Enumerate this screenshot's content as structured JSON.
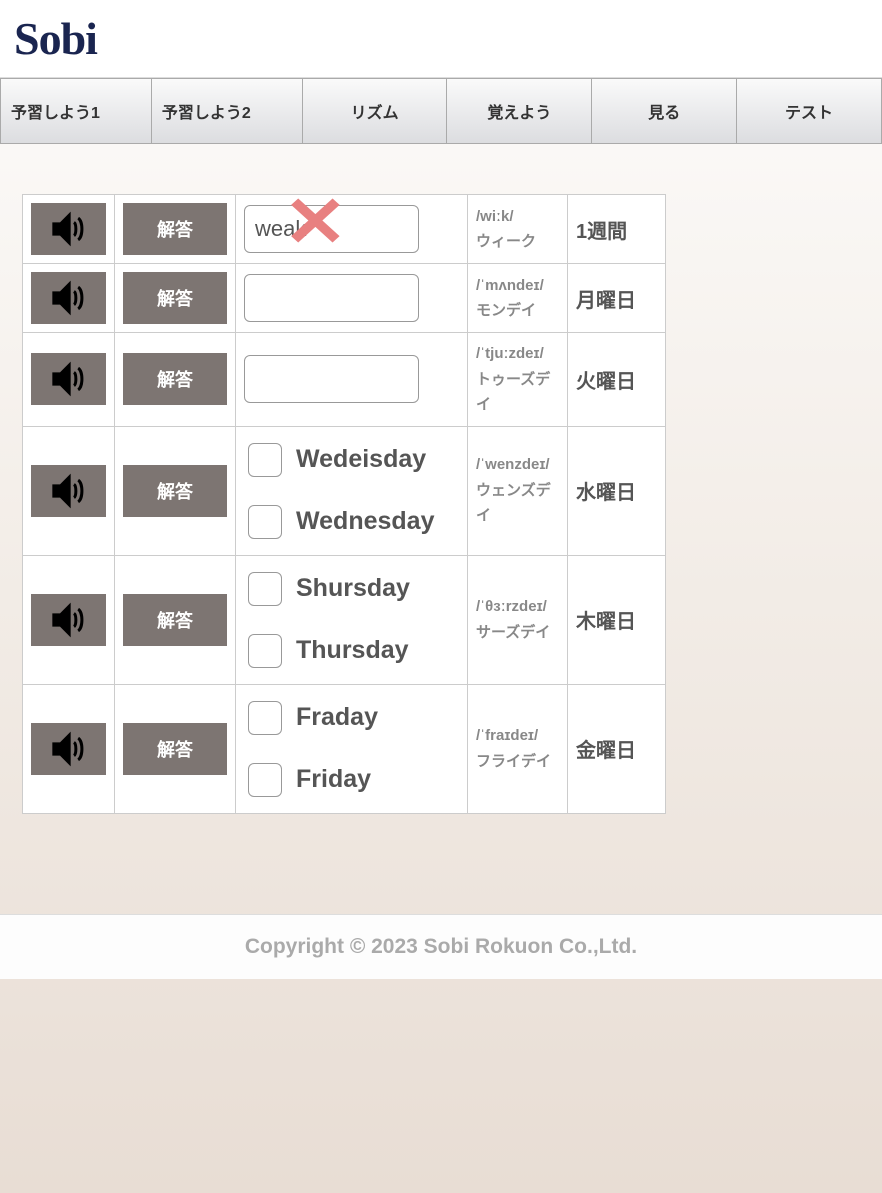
{
  "logo": "Sobi",
  "tabs": [
    "予習しよう1",
    "予習しよう2",
    "リズム",
    "覚えよう",
    "見る",
    "テスト"
  ],
  "answer_label": "解答",
  "rows": [
    {
      "type": "input",
      "input_value": "weak",
      "wrong": true,
      "phonetic": "/wiːk/\nウィーク",
      "japanese": "1週間"
    },
    {
      "type": "input",
      "input_value": "",
      "wrong": false,
      "phonetic": "/ˈmʌndeɪ/\nモンデイ",
      "japanese": "月曜日"
    },
    {
      "type": "input",
      "input_value": "",
      "wrong": false,
      "phonetic": "/ˈtjuːzdeɪ/\nトゥーズデイ",
      "japanese": "火曜日"
    },
    {
      "type": "choice",
      "options": [
        "Wedeisday",
        "Wednesday"
      ],
      "phonetic": "/ˈwenzdeɪ/\nウェンズデイ",
      "japanese": "水曜日"
    },
    {
      "type": "choice",
      "options": [
        "Shursday",
        "Thursday"
      ],
      "phonetic": "/ˈθɜːrzdeɪ/\nサーズデイ",
      "japanese": "木曜日"
    },
    {
      "type": "choice",
      "options": [
        "Fraday",
        "Friday"
      ],
      "phonetic": "/ˈfraɪdeɪ/\nフライデイ",
      "japanese": "金曜日"
    }
  ],
  "footer": "Copyright © 2023 Sobi Rokuon Co.,Ltd."
}
